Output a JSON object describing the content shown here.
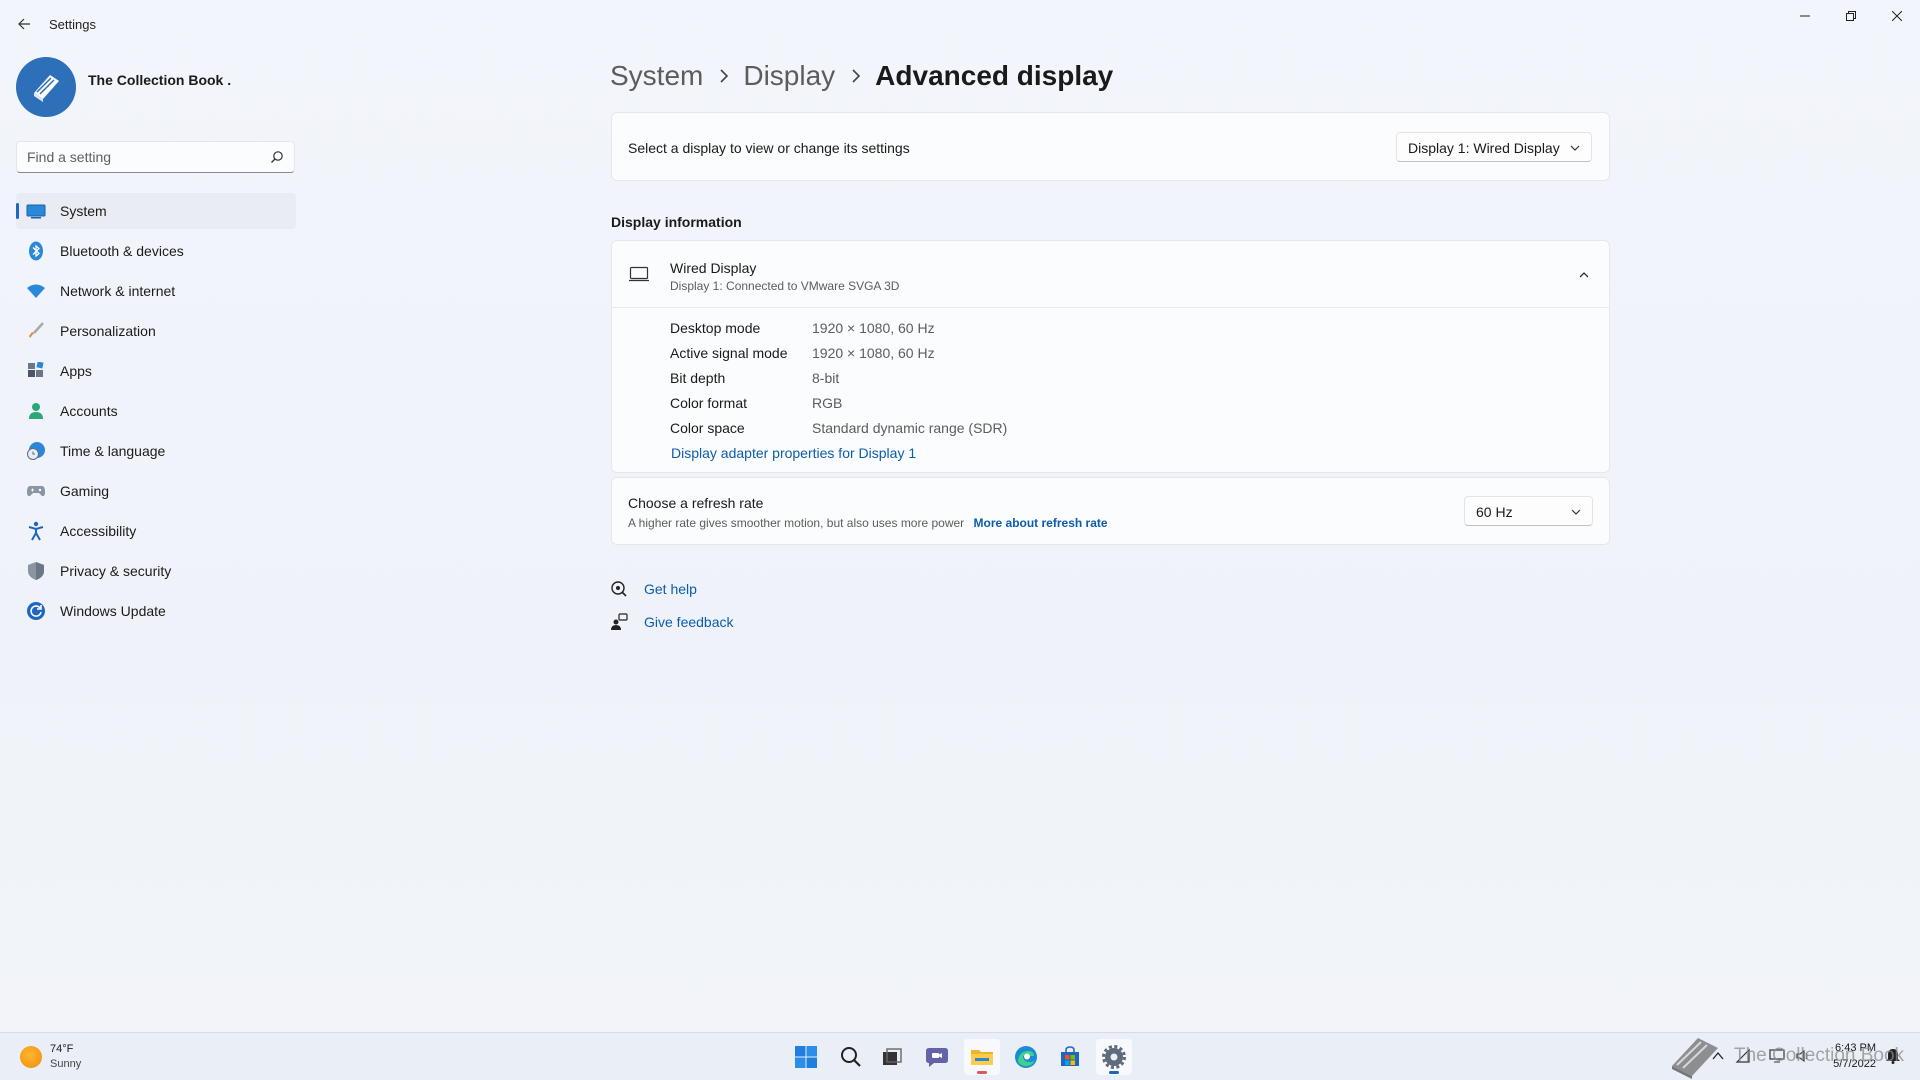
{
  "window": {
    "app_title": "Settings"
  },
  "profile": {
    "name": "The Collection Book ."
  },
  "search": {
    "placeholder": "Find a setting",
    "value": ""
  },
  "sidebar": {
    "items": [
      {
        "label": "System",
        "icon": "monitor-icon",
        "active": true
      },
      {
        "label": "Bluetooth & devices",
        "icon": "bluetooth-icon"
      },
      {
        "label": "Network & internet",
        "icon": "wifi-icon"
      },
      {
        "label": "Personalization",
        "icon": "brush-icon"
      },
      {
        "label": "Apps",
        "icon": "apps-icon"
      },
      {
        "label": "Accounts",
        "icon": "person-icon"
      },
      {
        "label": "Time & language",
        "icon": "globe-clock-icon"
      },
      {
        "label": "Gaming",
        "icon": "gamepad-icon"
      },
      {
        "label": "Accessibility",
        "icon": "accessibility-icon"
      },
      {
        "label": "Privacy & security",
        "icon": "shield-icon"
      },
      {
        "label": "Windows Update",
        "icon": "update-icon"
      }
    ]
  },
  "breadcrumb": {
    "items": [
      "System",
      "Display"
    ],
    "current": "Advanced display"
  },
  "display_select": {
    "label": "Select a display to view or change its settings",
    "selected": "Display 1: Wired Display"
  },
  "display_info": {
    "section_title": "Display information",
    "name": "Wired Display",
    "subtitle": "Display 1: Connected to VMware SVGA 3D",
    "rows": [
      {
        "key": "Desktop mode",
        "value": "1920 × 1080, 60 Hz"
      },
      {
        "key": "Active signal mode",
        "value": "1920 × 1080, 60 Hz"
      },
      {
        "key": "Bit depth",
        "value": "8-bit"
      },
      {
        "key": "Color format",
        "value": "RGB"
      },
      {
        "key": "Color space",
        "value": "Standard dynamic range (SDR)"
      }
    ],
    "adapter_link": "Display adapter properties for Display 1"
  },
  "refresh_rate": {
    "title": "Choose a refresh rate",
    "description": "A higher rate gives smoother motion, but also uses more power",
    "link": "More about refresh rate",
    "selected": "60 Hz"
  },
  "help": {
    "get_help": "Get help",
    "give_feedback": "Give feedback"
  },
  "taskbar": {
    "weather_temp": "74°F",
    "weather_condition": "Sunny",
    "apps": [
      "start-icon",
      "search-icon",
      "task-view-icon",
      "teams-chat-icon",
      "file-explorer-icon",
      "edge-icon",
      "store-icon",
      "settings-icon"
    ],
    "time": "6:43 PM",
    "date": "5/7/2022"
  },
  "watermark": {
    "text": "The Collection Book"
  },
  "colors": {
    "accent": "#1f66c1",
    "link": "#0b5cad",
    "background": "#f2f5fb"
  }
}
